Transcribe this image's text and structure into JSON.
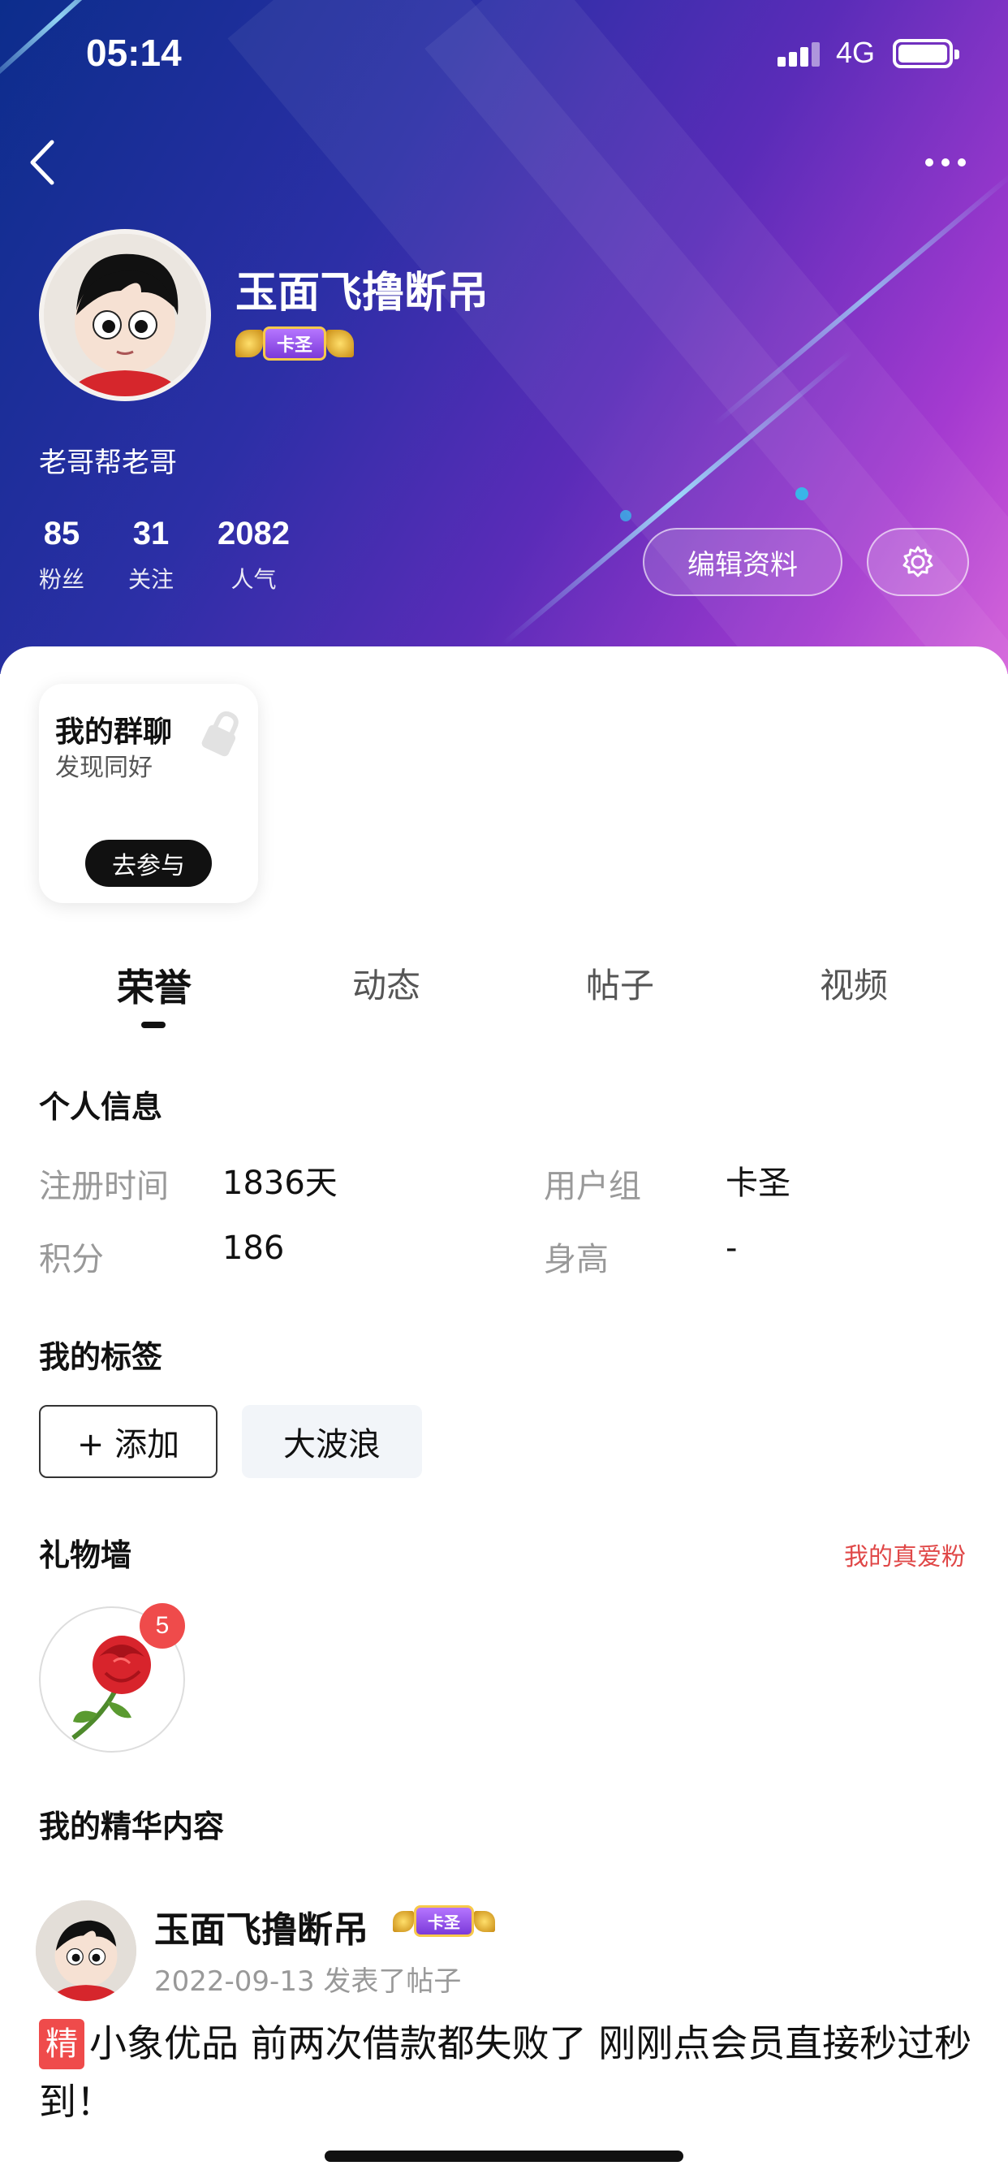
{
  "status_bar": {
    "time": "05:14",
    "network": "4G"
  },
  "profile": {
    "username": "玉面飞撸断吊",
    "badge": "卡圣",
    "bio": "老哥帮老哥",
    "stats": [
      {
        "value": "85",
        "label": "粉丝"
      },
      {
        "value": "31",
        "label": "关注"
      },
      {
        "value": "2082",
        "label": "人气"
      }
    ],
    "edit_button": "编辑资料"
  },
  "group_card": {
    "title": "我的群聊",
    "subtitle": "发现同好",
    "button": "去参与"
  },
  "tabs": [
    {
      "label": "荣誉",
      "active": true
    },
    {
      "label": "动态",
      "active": false
    },
    {
      "label": "帖子",
      "active": false
    },
    {
      "label": "视频",
      "active": false
    }
  ],
  "personal_info": {
    "title": "个人信息",
    "fields": [
      {
        "label": "注册时间",
        "value": "1836天"
      },
      {
        "label": "用户组",
        "value": "卡圣"
      },
      {
        "label": "积分",
        "value": "186"
      },
      {
        "label": "身高",
        "value": "-"
      }
    ]
  },
  "tags": {
    "title": "我的标签",
    "add_label": "+ 添加",
    "items": [
      "大波浪"
    ]
  },
  "gift_wall": {
    "title": "礼物墙",
    "link": "我的真爱粉",
    "gift_icon": "rose-icon",
    "count": "5"
  },
  "featured": {
    "title": "我的精华内容",
    "post": {
      "author": "玉面飞撸断吊",
      "badge": "卡圣",
      "meta": "2022-09-13 发表了帖子",
      "tag": "精",
      "text": "小象优品 前两次借款都失败了 刚刚点会员直接秒过秒到！"
    }
  },
  "colors": {
    "accent_red": "#ef4b4b",
    "badge_purple": "#8a45e0",
    "badge_gold": "#f7c94a"
  }
}
